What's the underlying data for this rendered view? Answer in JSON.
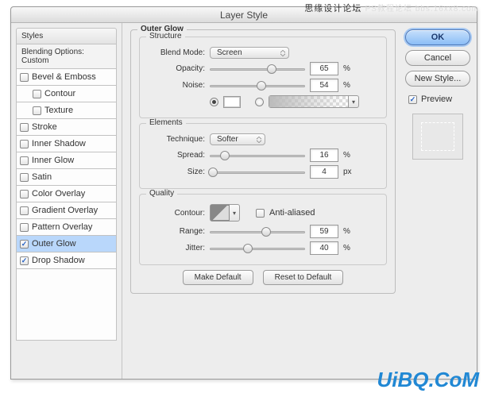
{
  "watermark": {
    "top_main": "思缘设计论坛",
    "top_sub": "PS教程论坛 bbs.16xx8.com",
    "bottom": "UiBQ.CoM"
  },
  "dialog": {
    "title": "Layer Style"
  },
  "sidebar": {
    "header": "Styles",
    "subheader": "Blending Options: Custom",
    "items": [
      {
        "label": "Bevel & Emboss",
        "checked": false
      },
      {
        "label": "Contour",
        "checked": false,
        "indent": true
      },
      {
        "label": "Texture",
        "checked": false,
        "indent": true
      },
      {
        "label": "Stroke",
        "checked": false
      },
      {
        "label": "Inner Shadow",
        "checked": false
      },
      {
        "label": "Inner Glow",
        "checked": false
      },
      {
        "label": "Satin",
        "checked": false
      },
      {
        "label": "Color Overlay",
        "checked": false
      },
      {
        "label": "Gradient Overlay",
        "checked": false
      },
      {
        "label": "Pattern Overlay",
        "checked": false
      },
      {
        "label": "Outer Glow",
        "checked": true,
        "selected": true
      },
      {
        "label": "Drop Shadow",
        "checked": true
      }
    ]
  },
  "panel": {
    "title": "Outer Glow",
    "structure": {
      "legend": "Structure",
      "blend_mode_label": "Blend Mode:",
      "blend_mode_value": "Screen",
      "opacity_label": "Opacity:",
      "opacity_value": "65",
      "opacity_unit": "%",
      "noise_label": "Noise:",
      "noise_value": "54",
      "noise_unit": "%"
    },
    "elements": {
      "legend": "Elements",
      "technique_label": "Technique:",
      "technique_value": "Softer",
      "spread_label": "Spread:",
      "spread_value": "16",
      "spread_unit": "%",
      "size_label": "Size:",
      "size_value": "4",
      "size_unit": "px"
    },
    "quality": {
      "legend": "Quality",
      "contour_label": "Contour:",
      "antialiased_label": "Anti-aliased",
      "range_label": "Range:",
      "range_value": "59",
      "range_unit": "%",
      "jitter_label": "Jitter:",
      "jitter_value": "40",
      "jitter_unit": "%"
    },
    "make_default": "Make Default",
    "reset_default": "Reset to Default"
  },
  "right": {
    "ok": "OK",
    "cancel": "Cancel",
    "new_style": "New Style...",
    "preview": "Preview"
  }
}
